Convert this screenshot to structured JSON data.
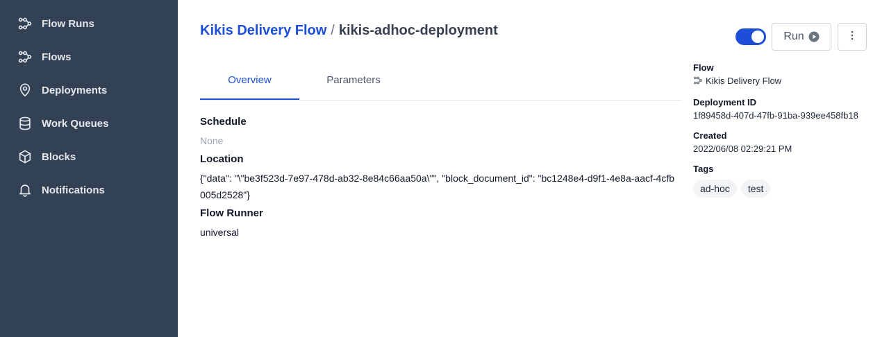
{
  "sidebar": {
    "items": [
      {
        "label": "Flow Runs",
        "icon": "flow-runs-icon"
      },
      {
        "label": "Flows",
        "icon": "flows-icon"
      },
      {
        "label": "Deployments",
        "icon": "location-pin-icon"
      },
      {
        "label": "Work Queues",
        "icon": "database-icon"
      },
      {
        "label": "Blocks",
        "icon": "cube-icon"
      },
      {
        "label": "Notifications",
        "icon": "bell-icon"
      }
    ]
  },
  "header": {
    "flow_link": "Kikis Delivery Flow",
    "separator": "/",
    "deployment_name": "kikis-adhoc-deployment",
    "run_label": "Run",
    "toggle_on": true
  },
  "tabs": [
    {
      "label": "Overview",
      "active": true
    },
    {
      "label": "Parameters",
      "active": false
    }
  ],
  "overview": {
    "schedule_title": "Schedule",
    "schedule_value": "None",
    "location_title": "Location",
    "location_value": "{\"data\": \"\\\"be3f523d-7e97-478d-ab32-8e84c66aa50a\\\"\", \"block_document_id\": \"bc1248e4-d9f1-4e8a-aacf-4cfb005d2528\"}",
    "flow_runner_title": "Flow Runner",
    "flow_runner_value": "universal"
  },
  "details": {
    "flow_label": "Flow",
    "flow_value": "Kikis Delivery Flow",
    "deployment_id_label": "Deployment ID",
    "deployment_id_value": "1f89458d-407d-47fb-91ba-939ee458fb18",
    "created_label": "Created",
    "created_value": "2022/06/08 02:29:21 PM",
    "tags_label": "Tags",
    "tags": [
      "ad-hoc",
      "test"
    ]
  },
  "colors": {
    "sidebar_bg": "#334155",
    "accent": "#1d4ed8"
  }
}
